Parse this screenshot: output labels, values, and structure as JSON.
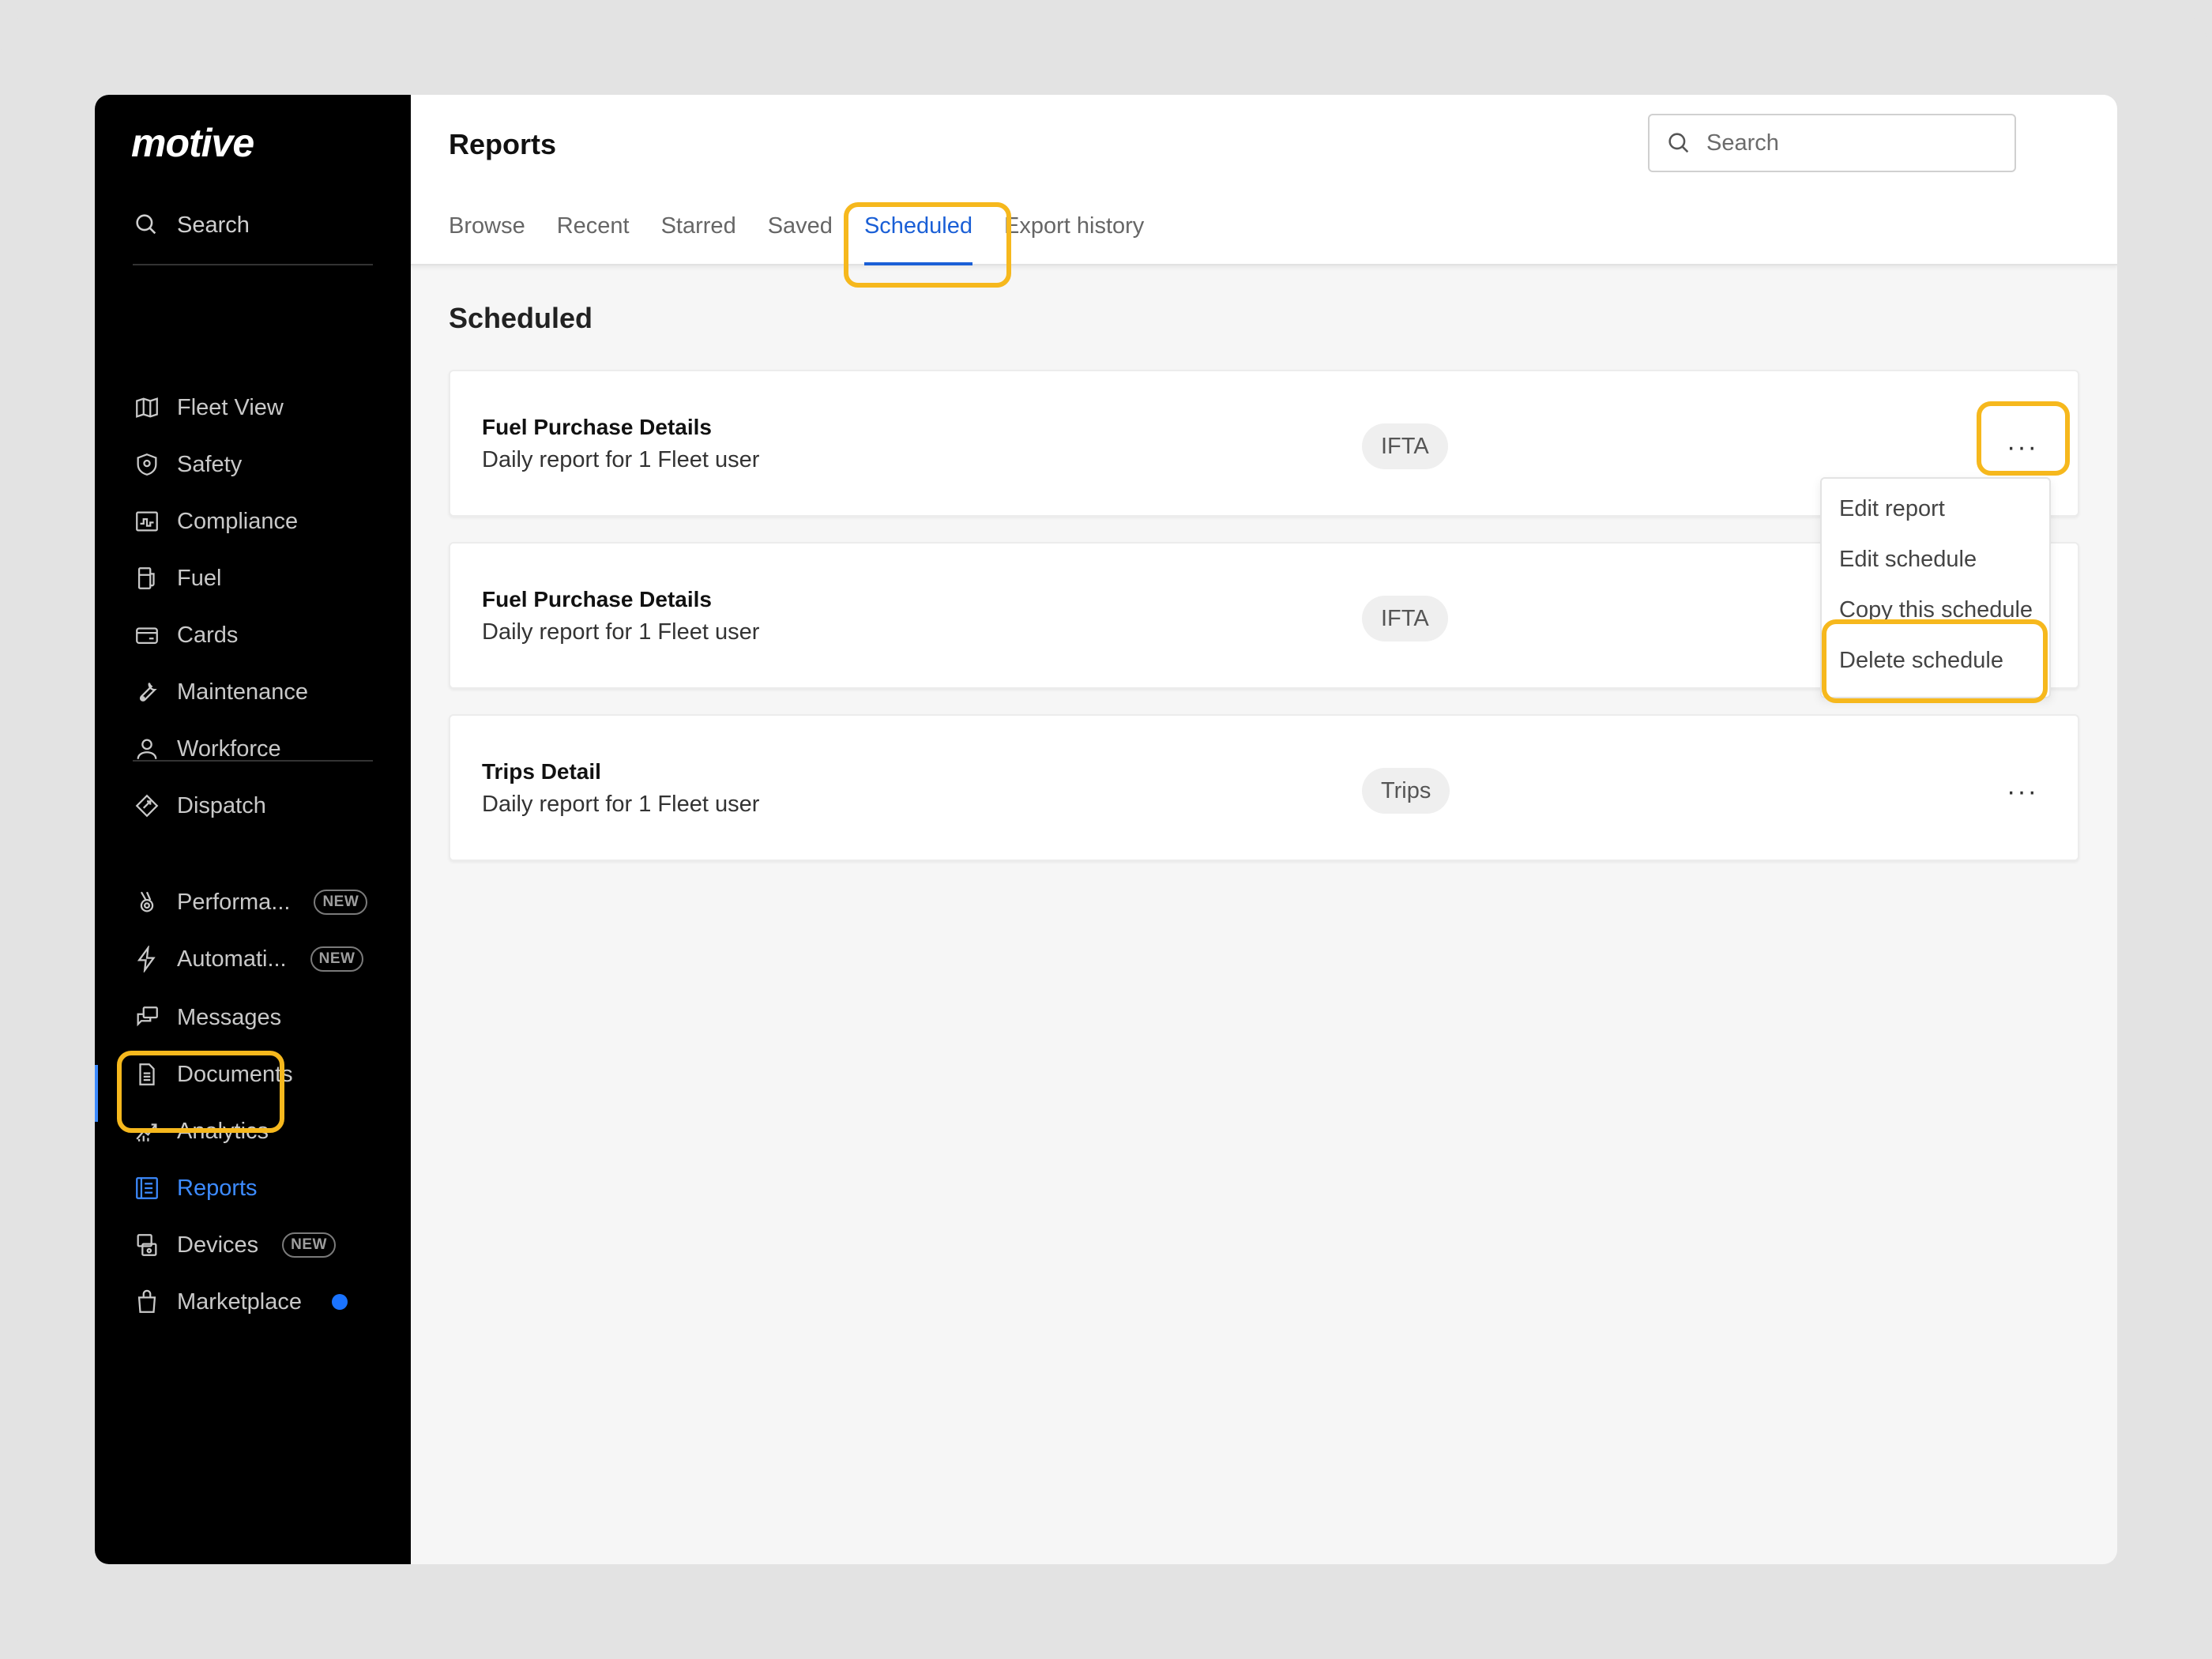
{
  "brand": {
    "logo_text": "motive"
  },
  "sidebar": {
    "search_label": "Search",
    "group1": [
      {
        "label": "Fleet View",
        "icon": "map-icon"
      },
      {
        "label": "Safety",
        "icon": "shield-icon"
      },
      {
        "label": "Compliance",
        "icon": "compliance-icon"
      },
      {
        "label": "Fuel",
        "icon": "fuel-icon"
      },
      {
        "label": "Cards",
        "icon": "card-icon"
      },
      {
        "label": "Maintenance",
        "icon": "wrench-icon"
      },
      {
        "label": "Workforce",
        "icon": "person-icon"
      },
      {
        "label": "Dispatch",
        "icon": "dispatch-icon"
      }
    ],
    "group2": [
      {
        "label": "Performa...",
        "icon": "medal-icon",
        "badge": "NEW"
      },
      {
        "label": "Automati...",
        "icon": "lightning-icon",
        "badge": "NEW"
      },
      {
        "label": "Messages",
        "icon": "messages-icon"
      },
      {
        "label": "Documents",
        "icon": "document-icon"
      },
      {
        "label": "Analytics",
        "icon": "analytics-icon"
      },
      {
        "label": "Reports",
        "icon": "reports-icon",
        "active": true
      },
      {
        "label": "Devices",
        "icon": "devices-icon",
        "badge": "NEW"
      },
      {
        "label": "Marketplace",
        "icon": "bag-icon",
        "dot": true
      }
    ]
  },
  "header": {
    "title": "Reports",
    "search_placeholder": "Search",
    "tabs": [
      "Browse",
      "Recent",
      "Starred",
      "Saved",
      "Scheduled",
      "Export history"
    ],
    "active_tab": "Scheduled"
  },
  "main": {
    "section_title": "Scheduled",
    "cards": [
      {
        "title": "Fuel Purchase Details",
        "subtitle": "Daily report for 1 Fleet user",
        "tag": "IFTA",
        "more": "···"
      },
      {
        "title": "Fuel Purchase Details",
        "subtitle": "Daily report for 1 Fleet user",
        "tag": "IFTA",
        "more": "···"
      },
      {
        "title": "Trips Detail",
        "subtitle": "Daily report for 1 Fleet user",
        "tag": "Trips",
        "more": "···"
      }
    ],
    "menu": [
      "Edit report",
      "Edit schedule",
      "Copy this schedule",
      "Delete schedule"
    ]
  },
  "colors": {
    "accent": "#1a5fd6",
    "sidebar_active": "#3d8bff",
    "highlight": "#f6b81d"
  }
}
